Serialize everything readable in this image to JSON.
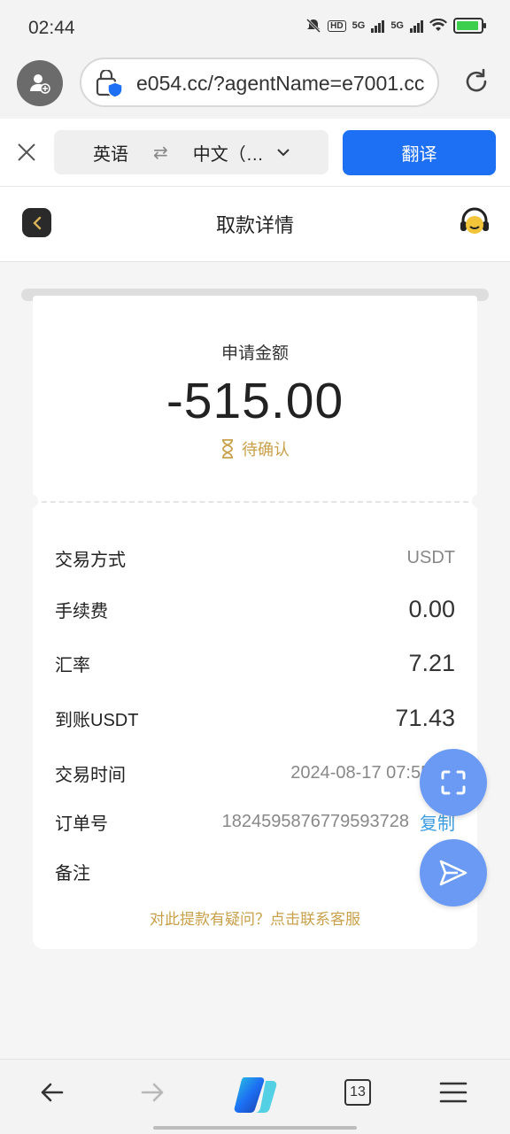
{
  "status_bar": {
    "time": "02:44",
    "net1": "5G",
    "net2": "5G"
  },
  "browser": {
    "url": "e054.cc/?agentName=e7001.cc"
  },
  "translate_bar": {
    "source_lang": "英语",
    "target_lang": "中文（…",
    "translate_button": "翻译"
  },
  "header": {
    "title": "取款详情"
  },
  "card": {
    "amount_label": "申请金额",
    "amount": "-515.00",
    "status": "待确认",
    "rows": [
      {
        "label": "交易方式",
        "value": "USDT"
      },
      {
        "label": "手续费",
        "value": "0.00"
      },
      {
        "label": "汇率",
        "value": "7.21"
      },
      {
        "label": "到账USDT",
        "value": "71.43"
      },
      {
        "label": "交易时间",
        "value": "2024-08-17 07:55:31"
      },
      {
        "label": "订单号",
        "value": "1824595876779593728",
        "action": "复制"
      },
      {
        "label": "备注",
        "value": ""
      }
    ],
    "help_link": "对此提款有疑问？点击联系客服"
  },
  "bottom_nav": {
    "tab_count": "13"
  },
  "colors": {
    "accent_blue": "#1d6ff3",
    "gold": "#c8a04a",
    "fab_blue": "#6a9af3",
    "copy_blue": "#3c9ce0"
  }
}
